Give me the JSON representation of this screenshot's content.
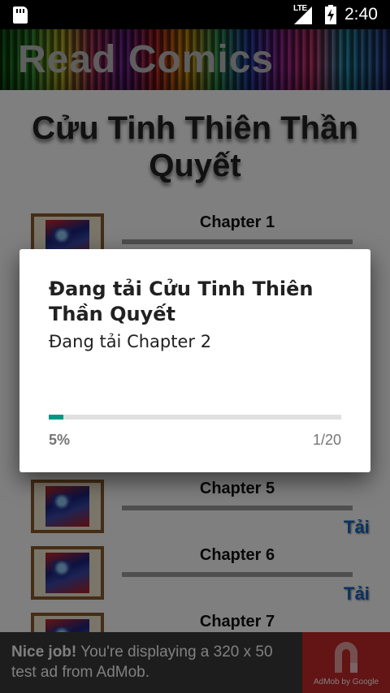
{
  "status_bar": {
    "network": "LTE",
    "time": "2:40",
    "icons": [
      "sd-card-icon",
      "lte-signal-icon",
      "battery-charging-icon"
    ]
  },
  "app": {
    "banner_title": "Read Comics"
  },
  "comic": {
    "title": "Cửu Tinh Thiên Thần Quyết"
  },
  "chapters": [
    {
      "label": "Chapter 1",
      "download": ""
    },
    {
      "label": "Chapter 5",
      "download": "Tải"
    },
    {
      "label": "Chapter 6",
      "download": "Tải"
    },
    {
      "label": "Chapter 7",
      "download": ""
    }
  ],
  "dialog": {
    "title": "Đang tải Cửu Tinh Thiên Thần Quyết",
    "message": "Đang tải Chapter 2",
    "progress_percent_label": "5%",
    "progress_fraction": 0.05,
    "progress_count": "1/20",
    "progress_color": "#009688"
  },
  "ad": {
    "headline": "Nice job!",
    "body": "You're displaying a 320 x 50 test ad from AdMob.",
    "brand": "AdMob by Google",
    "brand_color": "#c62828"
  }
}
